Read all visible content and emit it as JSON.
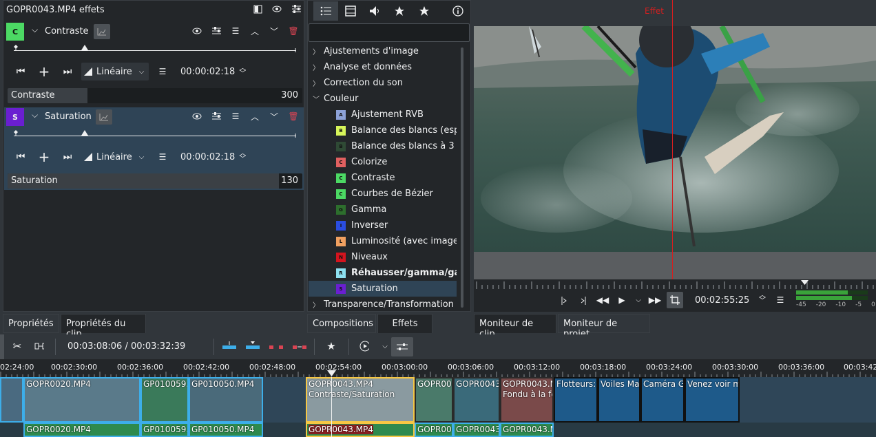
{
  "effects_panel": {
    "title": "GOPR0043.MP4 effets",
    "effects": [
      {
        "badge": "C",
        "badge_color": "#4cd964",
        "name": "Contraste",
        "interp": "Linéaire",
        "timecode": "00:00:02:18",
        "param_label": "Contraste",
        "param_value": "300",
        "param_fraction": 0.27
      },
      {
        "badge": "S",
        "badge_color": "#6a1fd1",
        "name": "Saturation",
        "interp": "Linéaire",
        "timecode": "00:00:02:18",
        "param_label": "Saturation",
        "param_value": "130",
        "param_fraction": 0.92
      }
    ]
  },
  "library": {
    "search_placeholder": "",
    "tree": [
      {
        "type": "folder",
        "label": "Ajustements d'image",
        "expanded": false
      },
      {
        "type": "folder",
        "label": "Analyse et données",
        "expanded": false
      },
      {
        "type": "folder",
        "label": "Correction du son",
        "expanded": false
      },
      {
        "type": "folder",
        "label": "Couleur",
        "expanded": true
      },
      {
        "type": "item",
        "badge": "A",
        "color": "#8da2d8",
        "label": "Ajustement RVB"
      },
      {
        "type": "item",
        "badge": "B",
        "color": "#d7f55a",
        "label": "Balance des blancs (esp"
      },
      {
        "type": "item",
        "badge": "B",
        "color": "#2f4a35",
        "label": "Balance des blancs à 3"
      },
      {
        "type": "item",
        "badge": "C",
        "color": "#e06060",
        "label": "Colorize"
      },
      {
        "type": "item",
        "badge": "C",
        "color": "#4cd964",
        "label": "Contraste"
      },
      {
        "type": "item",
        "badge": "C",
        "color": "#4cd964",
        "label": "Courbes de Bézier"
      },
      {
        "type": "item",
        "badge": "G",
        "color": "#2d6e2d",
        "label": "Gamma"
      },
      {
        "type": "item",
        "badge": "I",
        "color": "#2a4de0",
        "label": "Inverser"
      },
      {
        "type": "item",
        "badge": "L",
        "color": "#f0a060",
        "label": "Luminosité (avec image"
      },
      {
        "type": "item",
        "badge": "N",
        "color": "#d4141e",
        "label": "Niveaux"
      },
      {
        "type": "item",
        "badge": "R",
        "color": "#8de0f0",
        "label": "Réhausser/gamma/ga",
        "bold": true
      },
      {
        "type": "item",
        "badge": "S",
        "color": "#6a1fd1",
        "label": "Saturation",
        "selected": true
      },
      {
        "type": "folder",
        "label": "Transparence/Transformation",
        "expanded": false
      }
    ]
  },
  "monitor": {
    "effect_marker": "Effet",
    "timecode": "00:02:55:25",
    "meter_labels": [
      "-45",
      "-20",
      "-10",
      "-5",
      "0"
    ]
  },
  "tabs": {
    "left": [
      "Propriétés",
      "Propriétés du clip"
    ],
    "middle": [
      "Compositions",
      "Effets"
    ],
    "right": [
      "Moniteur de clip",
      "Moniteur de projet"
    ]
  },
  "timeline": {
    "position": "00:03:08:06 / 00:03:32:39",
    "ruler_ticks": [
      "02:24:00",
      "00:02:30:00",
      "00:02:36:00",
      "00:02:42:00",
      "00:02:48:00",
      "00:02:54:00",
      "00:03:00:00",
      "00:03:06:00",
      "00:03:12:00",
      "00:03:18:00",
      "00:03:24:00",
      "00:03:30:00",
      "00:03:36:00",
      "00:03:42"
    ],
    "video_clips": [
      {
        "label": "GOPR0020.MP4",
        "color": "#5a7a8a"
      },
      {
        "label": "GP010059.MP4",
        "color": "#3a7a5a"
      },
      {
        "label": "GP010050.MP4",
        "color": "#4a6a7a"
      },
      {
        "label": "GOPR0043.MP4",
        "sub": "Contraste/Saturation",
        "color": "#8a9aa0"
      },
      {
        "label": "GOPR004",
        "color": "#4a7a6a"
      },
      {
        "label": "GOPR0043.",
        "color": "#3a6a7a"
      },
      {
        "label": "GOPR0043.MP",
        "sub": "Fondu à la fer",
        "color": "#7a4a4a"
      },
      {
        "label": "Flotteurs: F",
        "color": "#1e5a8a"
      },
      {
        "label": "Voiles Mau",
        "color": "#1e5a8a"
      },
      {
        "label": "Caméra Gc",
        "color": "#1e5a8a"
      },
      {
        "label": "Venez voir m",
        "color": "#1e5a8a"
      }
    ],
    "audio_clips": [
      {
        "label": "GOPR0020.MP4"
      },
      {
        "label": "GP010059.M"
      },
      {
        "label": "GP010050.MP4"
      },
      {
        "label": "GOPR0043.MP4"
      },
      {
        "label": "GOPR004"
      },
      {
        "label": "GOPR0043."
      },
      {
        "label": "GOPR0043.MP"
      }
    ]
  }
}
